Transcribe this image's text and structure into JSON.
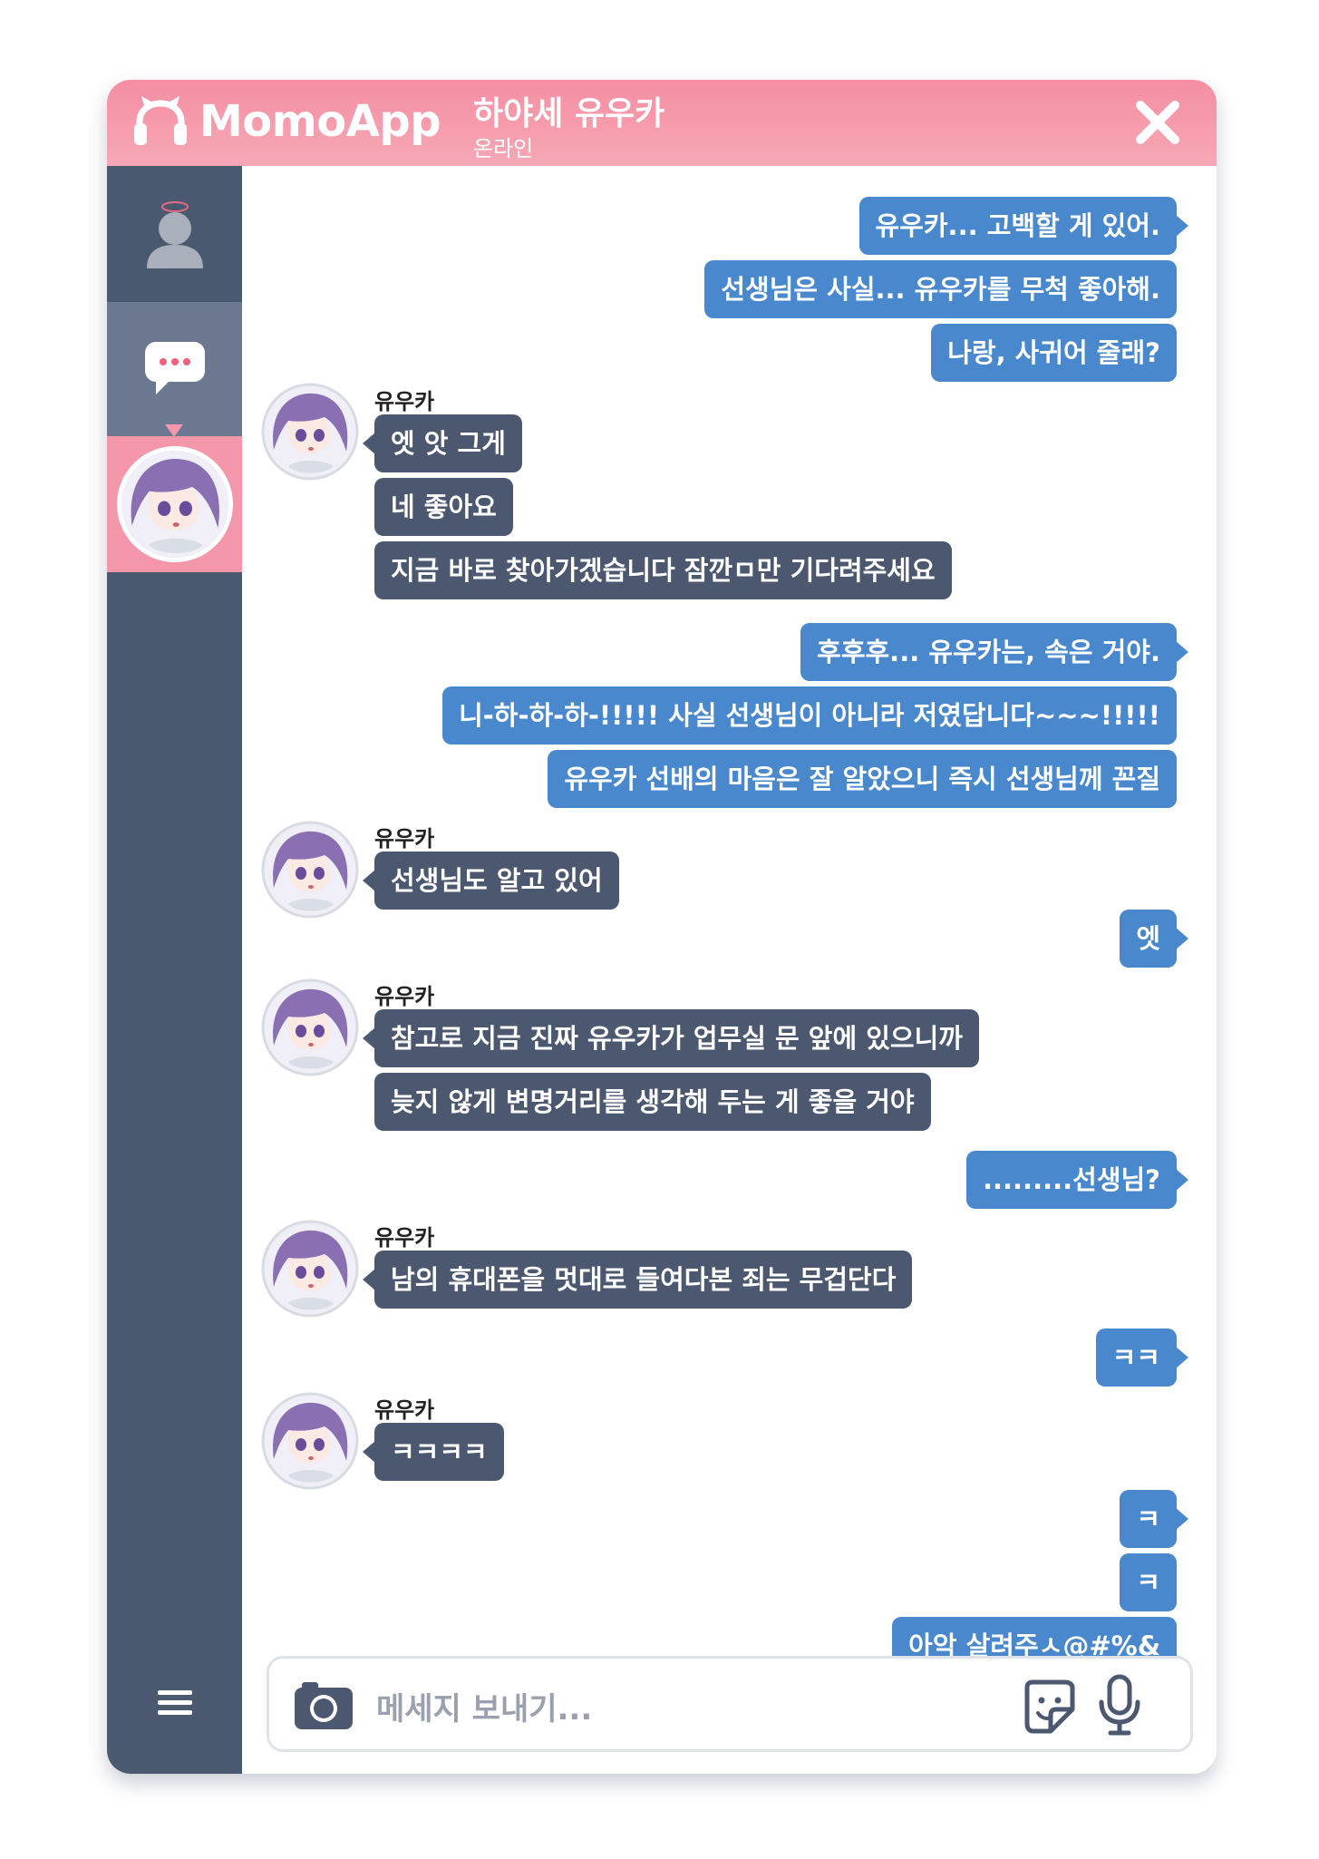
{
  "app": {
    "name": "MomoApp"
  },
  "contact": {
    "name": "하야세 유우카",
    "status": "온라인"
  },
  "sidebar": {
    "items": [
      {
        "name": "profile",
        "icon": "user-icon"
      },
      {
        "name": "chats",
        "icon": "chat-bubble-icon",
        "active": true
      },
      {
        "name": "yuuka",
        "icon": "avatar"
      },
      {
        "name": "menu",
        "icon": "hamburger-menu-icon"
      }
    ]
  },
  "messages": [
    {
      "from": "me",
      "text": "유우카... 고백할 게 있어."
    },
    {
      "from": "me",
      "text": "선생님은 사실... 유우카를 무척 좋아해."
    },
    {
      "from": "me",
      "text": "나랑, 사귀어 줄래?"
    },
    {
      "from": "yuuka",
      "sender": "유우카",
      "text": "엣 앗 그게"
    },
    {
      "from": "yuuka",
      "text": "네 좋아요"
    },
    {
      "from": "yuuka",
      "text": "지금 바로 찾아가겠습니다 잠깐ㅁ만 기다려주세요"
    },
    {
      "from": "me",
      "text": "후후후... 유우카는, 속은 거야."
    },
    {
      "from": "me",
      "text": "니-하-하-하-!!!!! 사실 선생님이 아니라 저였답니다~~~!!!!!"
    },
    {
      "from": "me",
      "text": "유우카 선배의 마음은 잘 알았으니 즉시 선생님께 꼰질"
    },
    {
      "from": "yuuka",
      "sender": "유우카",
      "text": "선생님도 알고 있어"
    },
    {
      "from": "me",
      "text": "엣"
    },
    {
      "from": "yuuka",
      "sender": "유우카",
      "text": "참고로 지금 진짜 유우카가 업무실 문 앞에 있으니까"
    },
    {
      "from": "yuuka",
      "text": "늦지 않게 변명거리를 생각해 두는 게 좋을 거야"
    },
    {
      "from": "me",
      "text": ".........선생님?"
    },
    {
      "from": "yuuka",
      "sender": "유우카",
      "text": "남의 휴대폰을 멋대로 들여다본 죄는 무겁단다"
    },
    {
      "from": "me",
      "text": "ㅋㅋ"
    },
    {
      "from": "yuuka",
      "sender": "유우카",
      "text": "ㅋㅋㅋㅋ"
    },
    {
      "from": "me",
      "text": "ㅋ"
    },
    {
      "from": "me",
      "text": "ㅋ"
    },
    {
      "from": "me",
      "text": "아악 살려주ㅅ@#%&"
    }
  ],
  "composer": {
    "placeholder": "메세지 보내기..."
  },
  "colors": {
    "header": "#f58ea2",
    "sidebar": "#4b5970",
    "sidebar_active": "#6b7890",
    "sidebar_selected": "#f497aa",
    "outgoing_bubble": "#4a88cd",
    "incoming_bubble": "#4b5870"
  }
}
